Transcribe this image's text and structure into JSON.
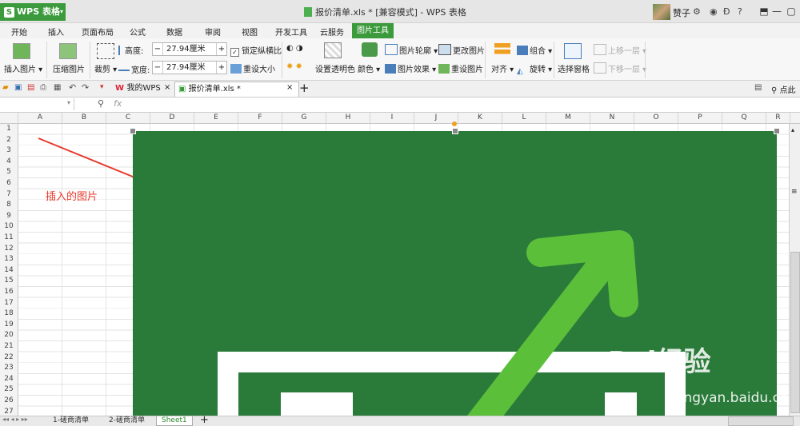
{
  "titlebar": {
    "app_label": "WPS 表格",
    "title": "报价清单.xls * [兼容模式] - WPS 表格",
    "user": "赞子",
    "help": "?"
  },
  "ribbon_tabs": [
    "开始",
    "插入",
    "页面布局",
    "公式",
    "数据",
    "审阅",
    "视图",
    "开发工具",
    "云服务",
    "图片工具"
  ],
  "active_tab": "图片工具",
  "ribbon": {
    "insert_picture": "插入图片",
    "compress_picture": "压缩图片",
    "crop": "裁剪",
    "height_label": "高度:",
    "height_value": "27.94厘米",
    "width_label": "宽度:",
    "width_value": "27.94厘米",
    "lock_ratio": "锁定纵横比",
    "reset_size": "重设大小",
    "set_transparent": "设置透明色",
    "color": "颜色",
    "picture_outline": "图片轮廓",
    "picture_effect": "图片效果",
    "change_picture": "更改图片",
    "reset_picture": "重设图片",
    "align": "对齐",
    "group": "组合",
    "rotate": "旋转",
    "selection_pane": "选择窗格",
    "bring_forward": "上移一层",
    "send_backward": "下移一层"
  },
  "quickbar": {
    "doc_tabs": [
      {
        "label": "我的WPS"
      },
      {
        "label": "报价清单.xls *"
      }
    ],
    "search_placeholder": "点此查"
  },
  "formula_bar": {
    "fx": "fx"
  },
  "grid": {
    "columns": [
      "A",
      "B",
      "C",
      "D",
      "E",
      "F",
      "G",
      "H",
      "I",
      "J",
      "K",
      "L",
      "M",
      "N",
      "O",
      "P",
      "Q",
      "R"
    ],
    "rows": [
      "1",
      "2",
      "3",
      "4",
      "5",
      "6",
      "7",
      "8",
      "9",
      "10",
      "11",
      "12",
      "13",
      "14",
      "15",
      "16",
      "17",
      "18",
      "19",
      "20",
      "21",
      "22",
      "23",
      "24",
      "25",
      "26",
      "27"
    ]
  },
  "annotation": "插入的图片",
  "sheets": [
    "1-磋商清单",
    "2-磋商清单",
    "Sheet1"
  ],
  "active_sheet": "Sheet1",
  "watermark": {
    "brand": "Bai经验",
    "url": "jingyan.baidu.com"
  },
  "colors": {
    "accent": "#3b9a3b",
    "picture_bg": "#2a7a3a",
    "arrow": "#5bbf3a",
    "annotation": "#e8392b"
  }
}
